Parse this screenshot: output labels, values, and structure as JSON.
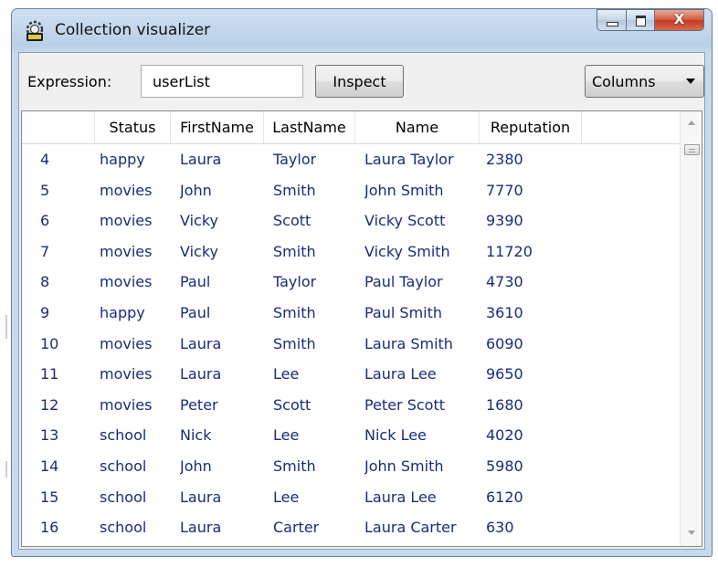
{
  "window": {
    "title": "Collection visualizer",
    "close_symbol": "X"
  },
  "toolbar": {
    "expression_label": "Expression:",
    "expression_value": "userList",
    "inspect_label": "Inspect",
    "columns_label": "Columns"
  },
  "table": {
    "headers": [
      "",
      "Status",
      "FirstName",
      "LastName",
      "Name",
      "Reputation"
    ],
    "rows": [
      [
        "4",
        "happy",
        "Laura",
        "Taylor",
        "Laura Taylor",
        "2380"
      ],
      [
        "5",
        "movies",
        "John",
        "Smith",
        "John Smith",
        "7770"
      ],
      [
        "6",
        "movies",
        "Vicky",
        "Scott",
        "Vicky Scott",
        "9390"
      ],
      [
        "7",
        "movies",
        "Vicky",
        "Smith",
        "Vicky Smith",
        "11720"
      ],
      [
        "8",
        "movies",
        "Paul",
        "Taylor",
        "Paul Taylor",
        "4730"
      ],
      [
        "9",
        "happy",
        "Paul",
        "Smith",
        "Paul Smith",
        "3610"
      ],
      [
        "10",
        "movies",
        "Laura",
        "Smith",
        "Laura Smith",
        "6090"
      ],
      [
        "11",
        "movies",
        "Laura",
        "Lee",
        "Laura Lee",
        "9650"
      ],
      [
        "12",
        "movies",
        "Peter",
        "Scott",
        "Peter Scott",
        "1680"
      ],
      [
        "13",
        "school",
        "Nick",
        "Lee",
        "Nick Lee",
        "4020"
      ],
      [
        "14",
        "school",
        "John",
        "Smith",
        "John Smith",
        "5980"
      ],
      [
        "15",
        "school",
        "Laura",
        "Lee",
        "Laura Lee",
        "6120"
      ],
      [
        "16",
        "school",
        "Laura",
        "Carter",
        "Laura Carter",
        "630"
      ]
    ]
  }
}
